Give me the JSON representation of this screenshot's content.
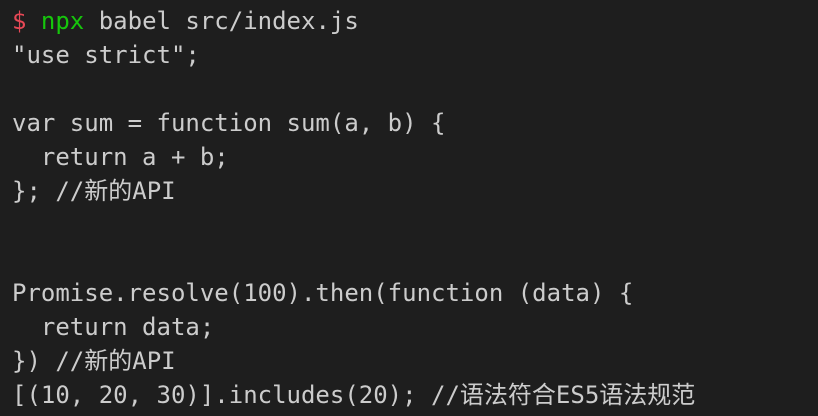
{
  "terminal": {
    "prompt": {
      "symbol": "$",
      "command": "npx",
      "args": " babel src/index.js"
    },
    "output_lines": [
      "\"use strict\";",
      "",
      "var sum = function sum(a, b) {",
      "  return a + b;",
      "}; //新的API",
      "",
      "",
      "Promise.resolve(100).then(function (data) {",
      "  return data;",
      "}) //新的API",
      "[(10, 20, 30)].includes(20); //语法符合ES5语法规范"
    ]
  },
  "colors": {
    "background": "#1e1e1e",
    "text": "#cccccc",
    "prompt_symbol": "#e74856",
    "command": "#16c60c"
  }
}
